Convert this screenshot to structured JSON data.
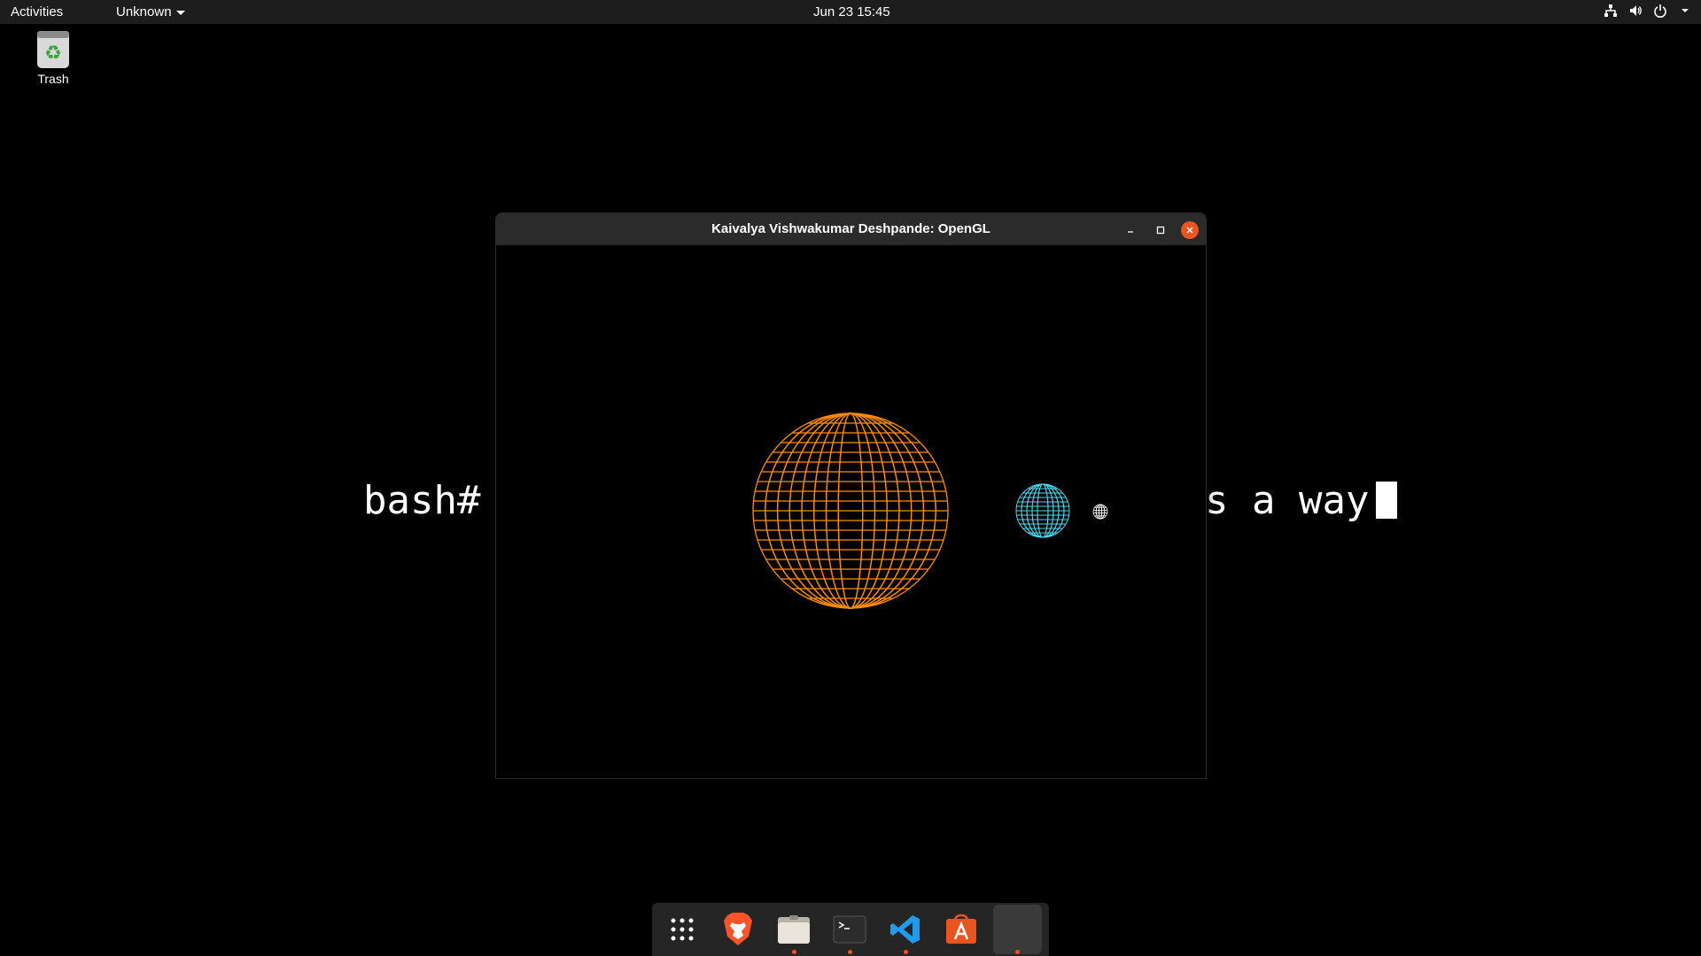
{
  "topbar": {
    "activities": "Activities",
    "app_menu": "Unknown",
    "clock": "Jun 23  15:45",
    "tray_icons": [
      "network-icon",
      "volume-icon",
      "power-icon",
      "chevron-down-icon"
    ]
  },
  "desktop": {
    "trash_label": "Trash"
  },
  "background_text": {
    "left": "bash#",
    "right": "s a way"
  },
  "window": {
    "title": "Kaivalya Vishwakumar Deshpande: OpenGL",
    "colors": {
      "sun": "#ff8c00",
      "planet": "#4fd8f0",
      "moon": "#ffffff"
    }
  },
  "dock": {
    "items": [
      {
        "name": "show-apps",
        "icon": "grid-icon"
      },
      {
        "name": "brave",
        "icon": "brave-lion-icon"
      },
      {
        "name": "files",
        "icon": "folder-icon"
      },
      {
        "name": "terminal",
        "icon": "terminal-icon"
      },
      {
        "name": "vscode",
        "icon": "vscode-icon"
      },
      {
        "name": "software",
        "icon": "app-store-icon"
      },
      {
        "name": "opengl-window",
        "icon": "blank-window-icon"
      }
    ]
  },
  "colors": {
    "accent": "#e95420",
    "topbar": "#1d1d1d",
    "dock": "#252525"
  }
}
